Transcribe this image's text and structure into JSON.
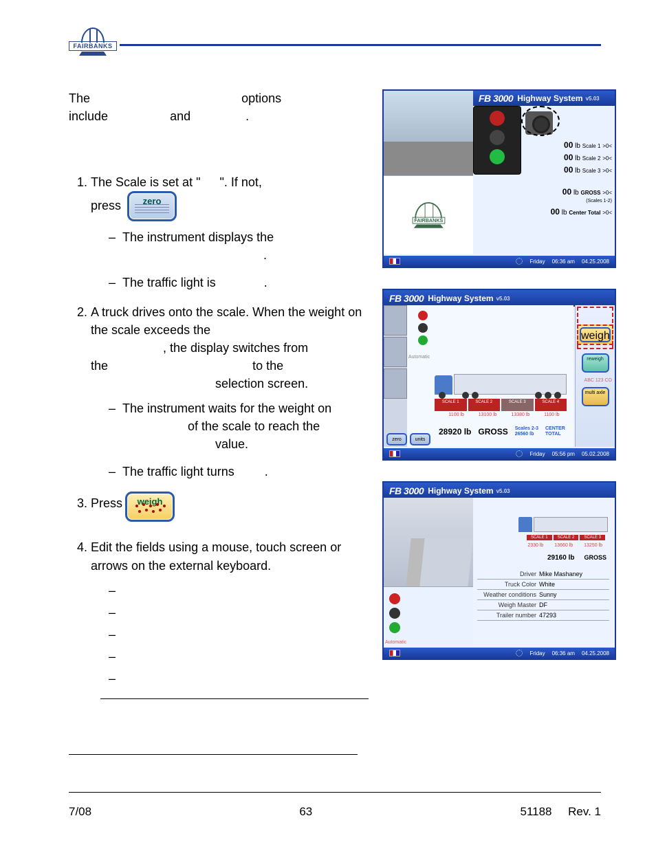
{
  "header": {
    "logo_text": "FAIRBANKS"
  },
  "intro": {
    "l1a": "The",
    "l1b": "options",
    "l2a": "include",
    "l2b": "and",
    "l2c": "."
  },
  "steps": {
    "s1": {
      "t1": "The Scale is set at \"",
      "t2": "\".  If not,",
      "t3": "press",
      "btn": "zero",
      "d1a": "The instrument displays the",
      "d1b": ".",
      "d2a": "The traffic light is",
      "d2b": "."
    },
    "s2": {
      "t1": "A truck drives onto the scale.  When the weight on the scale exceeds the",
      "t2": ", the display switches from",
      "t3": "the",
      "t4": "to the",
      "t5": "selection screen.",
      "d1a": "The instrument waits for the weight on",
      "d1b": "of the scale to reach the",
      "d1c": "value.",
      "d2a": "The traffic light turns",
      "d2b": "."
    },
    "s3": {
      "t1": "Press",
      "btn": "weigh"
    },
    "s4": {
      "t1": "Edit the fields using a mouse, touch screen or arrows on the external keyboard."
    }
  },
  "shot_common": {
    "fb": "FB 3000",
    "sys": "Highway System",
    "status_day": "Friday"
  },
  "shot1": {
    "ver": "v5.03",
    "s1": {
      "v": "00",
      "u": "lb",
      "l": "Scale 1",
      "o": ">0<"
    },
    "s2": {
      "v": "00",
      "u": "lb",
      "l": "Scale 2",
      "o": ">0<"
    },
    "s3": {
      "v": "00",
      "u": "lb",
      "l": "Scale 3",
      "o": ">0<"
    },
    "g": {
      "v": "00",
      "u": "lb",
      "l": "GROSS",
      "o": ">0<",
      "sub": "(Scales 1-2)"
    },
    "c": {
      "v": "00",
      "u": "lb",
      "l": "Center Total",
      "o": ">0<"
    },
    "time": "06:36 am",
    "date": "04.25.2008",
    "logo": "FAIRBANKS"
  },
  "shot2": {
    "ver": "v5.03",
    "auto": "Automatic",
    "ax": [
      "SCALE 1",
      "SCALE 2",
      "SCALE 3",
      "SCALE 4"
    ],
    "axw": [
      "1100 lb",
      "13100 lb",
      "13380 lb",
      "1100 lb"
    ],
    "gross_v": "28920 lb",
    "gross_l": "GROSS",
    "sub1t": "Scales 2-3",
    "sub1v": "26560 lb",
    "sub2t": "CENTER",
    "sub2v": "TOTAL",
    "btn_weigh": "weigh",
    "btn_reweigh": "reweigh",
    "btn_multi": "multi axle",
    "plate": "ABC 123 CO",
    "bb1": "zero",
    "bb2": "units",
    "time": "05:56 pm",
    "date": "05.02.2008"
  },
  "shot3": {
    "ver": "v5.03",
    "auto": "Automatic",
    "ax": [
      "SCALE 1",
      "SCALE 2",
      "SCALE 3"
    ],
    "axw": [
      "2330 lb",
      "13660 lb",
      "13250 lb"
    ],
    "gross_v": "29160 lb",
    "gross_l": "GROSS",
    "form": [
      {
        "k": "Driver",
        "v": "Mike Mashaney"
      },
      {
        "k": "Truck Color",
        "v": "White"
      },
      {
        "k": "Weather conditions",
        "v": "Sunny"
      },
      {
        "k": "Weigh Master",
        "v": "DF"
      },
      {
        "k": "Trailer number",
        "v": "47293"
      }
    ],
    "time": "06:36 am",
    "date": "04.25.2008"
  },
  "footer": {
    "left": "7/08",
    "center": "63",
    "right": "51188     Rev. 1"
  }
}
